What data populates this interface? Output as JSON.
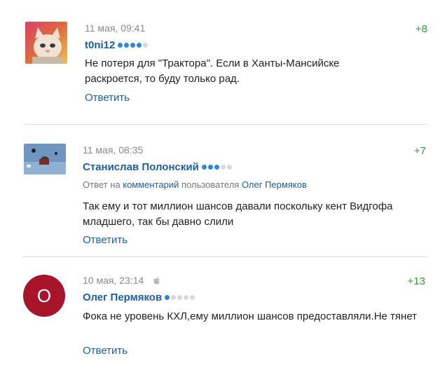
{
  "comments": [
    {
      "time": "11 мая, 09:41",
      "score": "+8",
      "author": "t0ni12",
      "rating_on": 4,
      "text": "Не потеря для \"Трактора\". Если в Ханты-Мансийске раскроется, то буду только рад.",
      "answer": "Ответить"
    },
    {
      "time": "11 мая, 08:35",
      "score": "+7",
      "author": "Станислав Полонский",
      "rating_on": 3,
      "reply_prefix": "Ответ на",
      "reply_link": "комментарий",
      "reply_middle": "пользователя",
      "reply_user": "Олег Пермяков",
      "text": "Так ему и тот миллион шансов давали поскольку кент Видгофа младшего, так бы давно слили",
      "answer": "Ответить"
    },
    {
      "time": "10 мая, 23:14",
      "device_icon": "apple-icon",
      "score": "+13",
      "author": "Олег Пермяков",
      "rating_on": 1,
      "avatar_letter": "О",
      "avatar_color": "#a8142a",
      "text": "Фока не уровень КХЛ,ему миллион шансов предоставляли.Не тянет",
      "answer": "Ответить"
    }
  ],
  "colors": {
    "link": "#1a5fa8",
    "score": "#2f9e3a",
    "meta": "#8a8a8a",
    "rating_dot_on": "#2f86d9",
    "rating_dot_off": "#d9d9d9"
  }
}
